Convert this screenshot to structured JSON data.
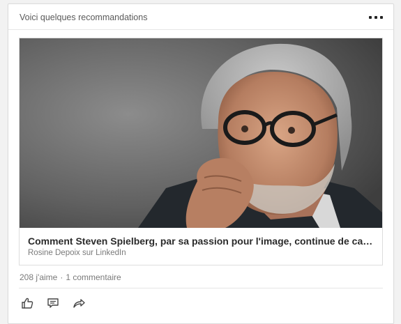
{
  "card": {
    "header_title": "Voici quelques recommandations",
    "more_icon": "more-horizontal-icon"
  },
  "article": {
    "image_icon": "portrait-photo",
    "title": "Comment Steven Spielberg, par sa passion pour l'image, continue de cap…",
    "source": "Rosine Depoix sur LinkedIn"
  },
  "social": {
    "likes": "208 j'aime",
    "separator": "·",
    "comments": "1 commentaire"
  },
  "actions": {
    "like_icon": "thumbs-up-icon",
    "comment_icon": "comment-icon",
    "share_icon": "share-icon"
  },
  "colors": {
    "text_primary": "#2b2b2b",
    "text_secondary": "#7a7a7a",
    "border": "#dddddd"
  }
}
